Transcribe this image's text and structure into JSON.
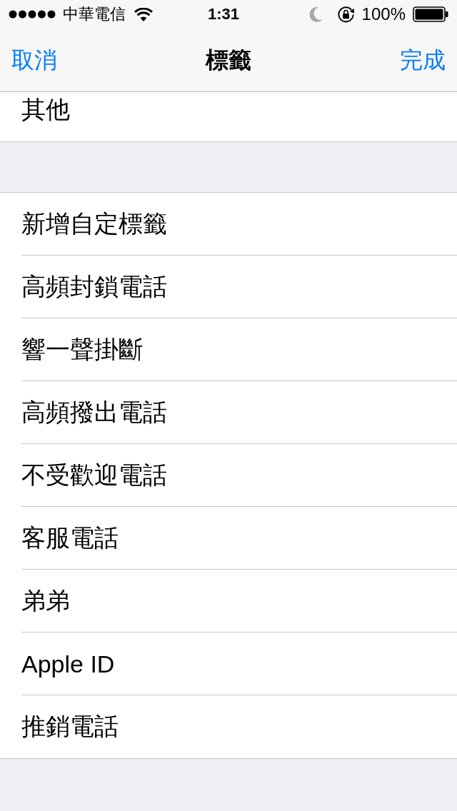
{
  "status_bar": {
    "carrier": "中華電信",
    "time": "1:31",
    "battery_percent": "100%"
  },
  "nav_bar": {
    "left_button": "取消",
    "title": "標籤",
    "right_button": "完成"
  },
  "sections": [
    {
      "rows": [
        {
          "label": "其他"
        }
      ]
    },
    {
      "rows": [
        {
          "label": "新增自定標籤"
        },
        {
          "label": "高頻封鎖電話"
        },
        {
          "label": "響一聲掛斷"
        },
        {
          "label": "高頻撥出電話"
        },
        {
          "label": "不受歡迎電話"
        },
        {
          "label": "客服電話"
        },
        {
          "label": "弟弟"
        },
        {
          "label": "Apple ID"
        },
        {
          "label": "推銷電話"
        }
      ]
    }
  ]
}
